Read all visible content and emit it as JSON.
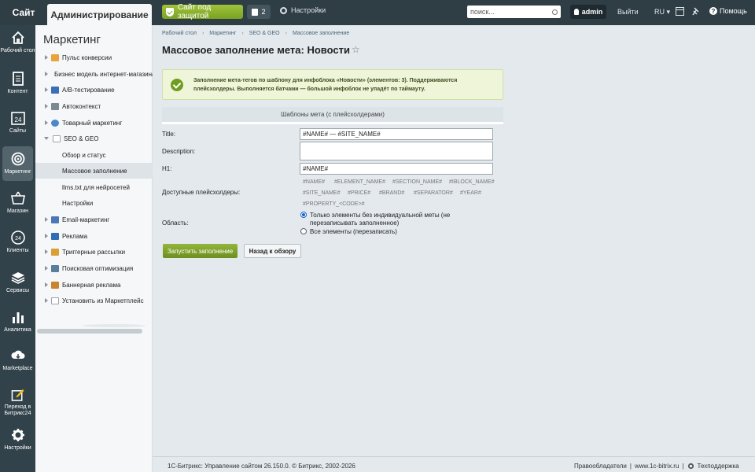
{
  "topbar": {
    "site_tab": "Сайт",
    "admin_tab": "Администрирование",
    "protected_label": "Сайт под защитой",
    "notifications_count": "2",
    "settings_label": "Настройки",
    "search_placeholder": "поиск...",
    "user_label": "admin",
    "logout_label": "Выйти",
    "lang_label": "RU",
    "help_label": "Помощь"
  },
  "leftnav": {
    "items": [
      {
        "label": "Рабочий стол",
        "icon": "home-icon"
      },
      {
        "label": "Контент",
        "icon": "document-icon"
      },
      {
        "label": "Сайты",
        "icon": "calendar-24-icon"
      },
      {
        "label": "Маркетинг",
        "icon": "target-icon"
      },
      {
        "label": "Магазин",
        "icon": "basket-icon"
      },
      {
        "label": "Клиенты",
        "icon": "clients-24-icon"
      },
      {
        "label": "Сервисы",
        "icon": "layers-icon"
      },
      {
        "label": "Аналитика",
        "icon": "bar-chart-icon"
      },
      {
        "label": "Marketplace",
        "icon": "cloud-download-icon"
      },
      {
        "label": "Переход в Битрикс24",
        "icon": "pencil-square-icon"
      },
      {
        "label": "Настройки",
        "icon": "gear-icon"
      }
    ]
  },
  "sidemenu": {
    "title": "Маркетинг",
    "items": [
      {
        "label": "Пульс конверсии",
        "level": 0,
        "expanded": false
      },
      {
        "label": "Бизнес модель интернет-магазина",
        "level": 0,
        "expanded": false
      },
      {
        "label": "A/B-тестирование",
        "level": 0,
        "expanded": false
      },
      {
        "label": "Автоконтекст",
        "level": 0,
        "expanded": false
      },
      {
        "label": "Товарный маркетинг",
        "level": 0,
        "expanded": false
      },
      {
        "label": "SEO & GEO",
        "level": 0,
        "expanded": true
      },
      {
        "label": "Обзор и статус",
        "level": 1
      },
      {
        "label": "Массовое заполнение",
        "level": 1,
        "active": true
      },
      {
        "label": "llms.txt для нейросетей",
        "level": 1
      },
      {
        "label": "Настройки",
        "level": 1
      },
      {
        "label": "Email-маркетинг",
        "level": 0,
        "expanded": false
      },
      {
        "label": "Реклама",
        "level": 0,
        "expanded": false
      },
      {
        "label": "Триггерные рассылки",
        "level": 0,
        "expanded": false
      },
      {
        "label": "Поисковая оптимизация",
        "level": 0,
        "expanded": false
      },
      {
        "label": "Баннерная реклама",
        "level": 0,
        "expanded": false
      },
      {
        "label": "Установить из Маркетплейс",
        "level": 0,
        "expanded": false
      }
    ]
  },
  "breadcrumb": [
    "Рабочий стол",
    "Маркетинг",
    "SEO & GEO",
    "Массовое заполнение"
  ],
  "page_title": "Массовое заполнение мета: Новости",
  "notice": "Заполнение мета-тегов по шаблону для инфоблока «Новости» (элементов: 3). Поддерживаются плейсхолдеры. Выполняется батчами — большой инфоблок не упадёт по таймауту.",
  "section_title": "Шаблоны мета (с плейсхолдерами)",
  "form": {
    "title_label": "Title:",
    "title_value": "#NAME# — #SITE_NAME#",
    "description_label": "Description:",
    "description_value": "",
    "h1_label": "H1:",
    "h1_value": "#NAME#",
    "placeholders_label": "Доступные плейсхолдеры:",
    "placeholders": [
      "#NAME#",
      "#ELEMENT_NAME#",
      "#SECTION_NAME#",
      "#IBLOCK_NAME#",
      "#SITE_NAME#",
      "#PRICE#",
      "#BRAND#",
      "#SEPARATOR#",
      "#YEAR#",
      "#PROPERTY_<CODE>#"
    ],
    "scope_label": "Область:",
    "scope_options": [
      {
        "label": "Только элементы без индивидуальной меты (не перезаписывать заполненное)",
        "selected": true
      },
      {
        "label": "Все элементы (перезаписать)",
        "selected": false
      }
    ]
  },
  "buttons": {
    "run": "Запустить заполнение",
    "back": "Назад к обзору"
  },
  "footer": {
    "copyright": "1С-Битрикс: Управление сайтом 26.150.0. © Битрикс, 2002-2026",
    "rights": "Правообладатели",
    "site": "www.1c-bitrix.ru",
    "support": "Техподдержка"
  }
}
